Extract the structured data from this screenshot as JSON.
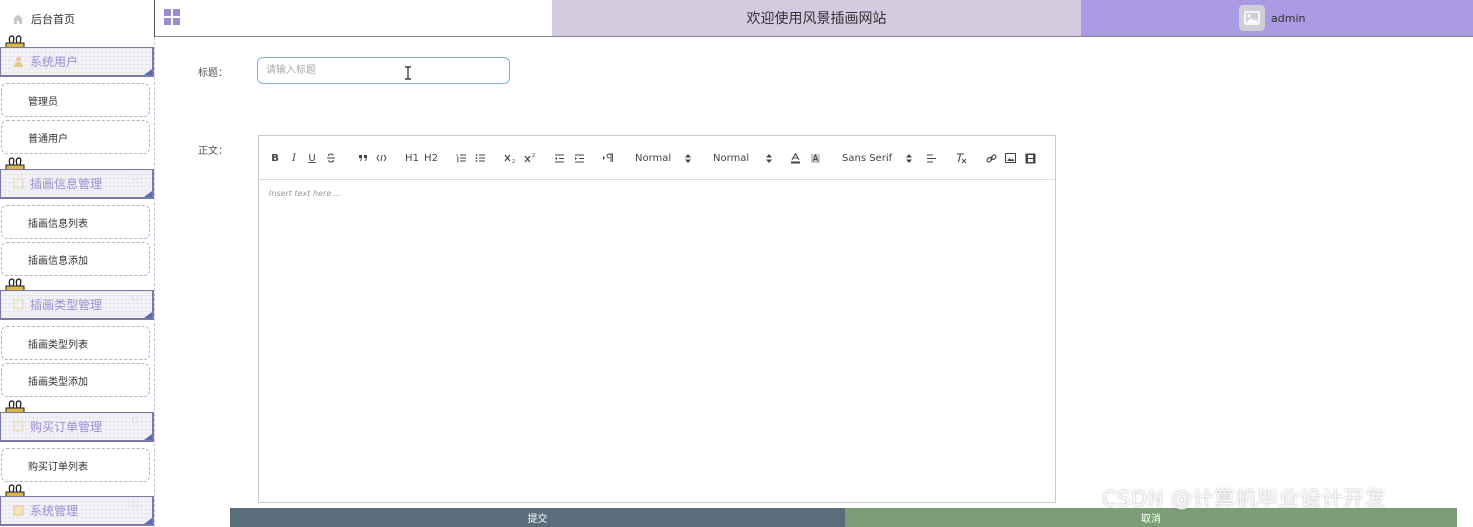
{
  "header": {
    "home_label": "后台首页",
    "welcome": "欢迎使用风景插画网站",
    "username": "admin"
  },
  "sidebar": {
    "groups": [
      {
        "label": "系统用户",
        "items": [
          "管理员",
          "普通用户"
        ]
      },
      {
        "label": "插画信息管理",
        "items": [
          "插画信息列表",
          "插画信息添加"
        ]
      },
      {
        "label": "插画类型管理",
        "items": [
          "插画类型列表",
          "插画类型添加"
        ]
      },
      {
        "label": "购买订单管理",
        "items": [
          "购买订单列表"
        ]
      },
      {
        "label": "系统管理",
        "items": []
      }
    ]
  },
  "form": {
    "title_label": "标题：",
    "title_placeholder": "请输入标题",
    "title_value": "",
    "content_label": "正文：",
    "editor_placeholder": "Insert text here ...",
    "toolbar": {
      "bold": "B",
      "italic": "I",
      "underline": "U",
      "h1": "H1",
      "h2": "H2",
      "size": "Normal",
      "header": "Normal",
      "font": "Sans Serif"
    },
    "submit_label": "提交",
    "cancel_label": "取消"
  },
  "watermark": "CSDN @计算机毕业设计开发",
  "colors": {
    "accent": "#aa9ae3",
    "welcome_bg": "#d4cbe1",
    "submit_bg": "#5a6d7b",
    "cancel_bg": "#7c9e77",
    "sidebar_text": "#9d8ed2"
  }
}
